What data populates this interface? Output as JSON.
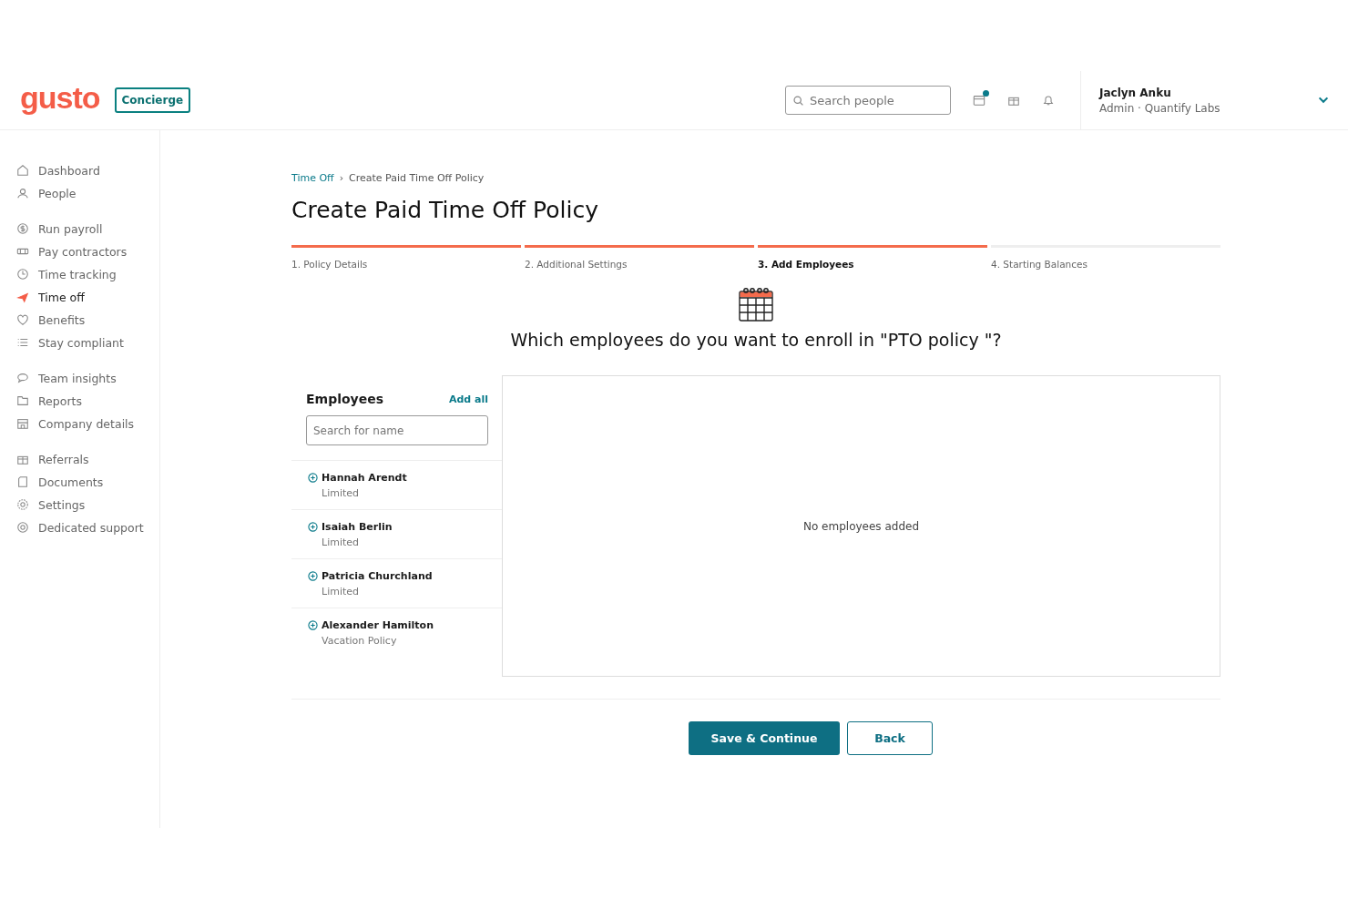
{
  "header": {
    "logo": "gusto",
    "badge": "Concierge",
    "search": {
      "placeholder": "Search people"
    },
    "calendar_notification": true,
    "user": {
      "name": "Jaclyn Anku",
      "role": "Admin · Quantify Labs"
    }
  },
  "sidebar": {
    "groups": [
      [
        {
          "label": "Dashboard",
          "selected": false
        },
        {
          "label": "People",
          "selected": false
        }
      ],
      [
        {
          "label": "Run payroll",
          "selected": false
        },
        {
          "label": "Pay contractors",
          "selected": false
        },
        {
          "label": "Time tracking",
          "selected": false
        },
        {
          "label": "Time off",
          "selected": true
        },
        {
          "label": "Benefits",
          "selected": false
        },
        {
          "label": "Stay compliant",
          "selected": false
        }
      ],
      [
        {
          "label": "Team insights",
          "selected": false
        },
        {
          "label": "Reports",
          "selected": false
        },
        {
          "label": "Company details",
          "selected": false
        }
      ],
      [
        {
          "label": "Referrals",
          "selected": false
        },
        {
          "label": "Documents",
          "selected": false
        },
        {
          "label": "Settings",
          "selected": false
        },
        {
          "label": "Dedicated support",
          "selected": false
        }
      ]
    ]
  },
  "breadcrumb": {
    "link": "Time Off",
    "separator": "›",
    "current": "Create Paid Time Off Policy"
  },
  "title": "Create Paid Time Off Policy",
  "steps": [
    {
      "label": "1. Policy Details",
      "complete": true,
      "current": false
    },
    {
      "label": "2. Additional Settings",
      "complete": true,
      "current": false
    },
    {
      "label": "3. Add Employees",
      "complete": true,
      "current": true
    },
    {
      "label": "4. Starting Balances",
      "complete": false,
      "current": false
    }
  ],
  "question": "Which employees do you want to enroll in \"PTO policy \"?",
  "employees": {
    "heading": "Employees",
    "add_all": "Add all",
    "search": {
      "placeholder": "Search for name"
    },
    "list": [
      {
        "name": "Hannah Arendt",
        "policy": "Limited"
      },
      {
        "name": "Isaiah Berlin",
        "policy": "Limited"
      },
      {
        "name": "Patricia Churchland",
        "policy": "Limited"
      },
      {
        "name": "Alexander Hamilton",
        "policy": "Vacation Policy"
      }
    ]
  },
  "enrolled": {
    "empty_message": "No employees added"
  },
  "buttons": {
    "primary": "Save & Continue",
    "secondary": "Back"
  }
}
